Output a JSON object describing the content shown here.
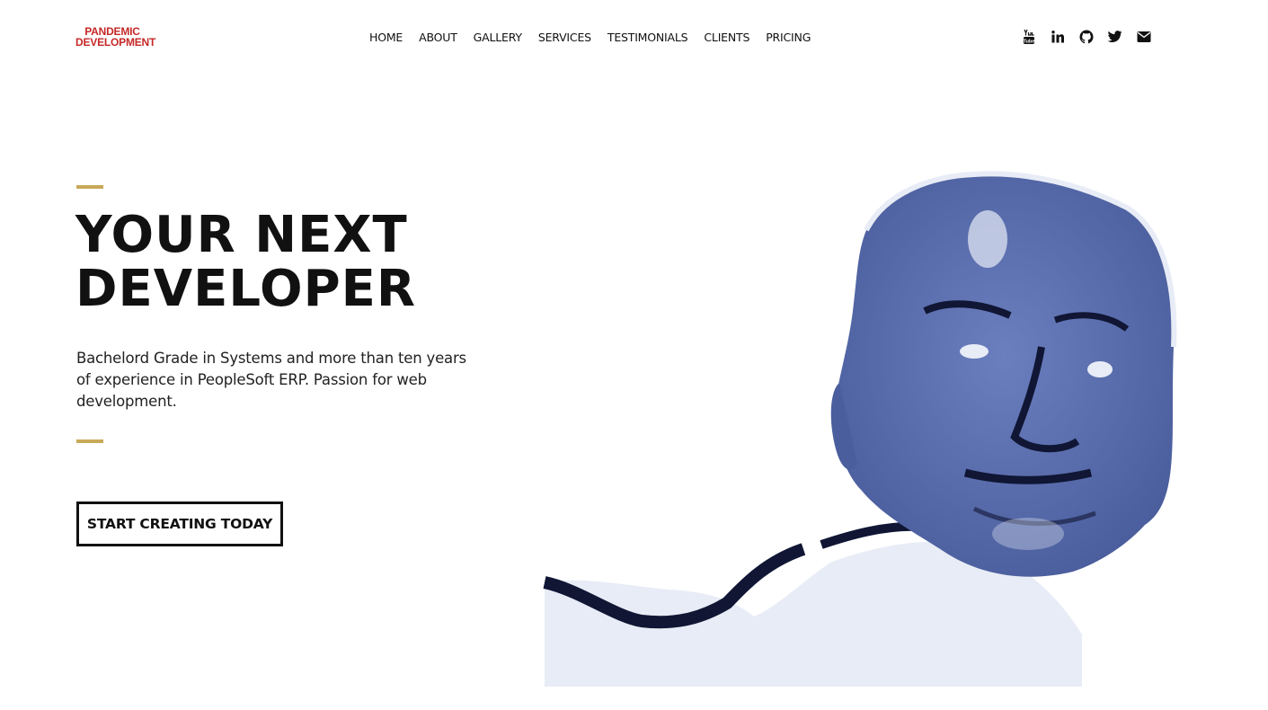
{
  "brand": {
    "line1": "PANDEMIC",
    "line2": "DEVELOPMENT",
    "color": "#c62828"
  },
  "nav": {
    "items": [
      {
        "label": "HOME"
      },
      {
        "label": "ABOUT"
      },
      {
        "label": "GALLERY"
      },
      {
        "label": "SERVICES"
      },
      {
        "label": "TESTIMONIALS"
      },
      {
        "label": "CLIENTS"
      },
      {
        "label": "PRICING"
      }
    ]
  },
  "social": {
    "icons": [
      "youtube-icon",
      "linkedin-icon",
      "github-icon",
      "twitter-icon",
      "envelope-icon"
    ],
    "youtube_text": "You Tube",
    "linkedin_text": "in"
  },
  "hero": {
    "title_line1": "YOUR NEXT",
    "title_line2": "DEVELOPER",
    "description": "Bachelord Grade in Systems and more than ten years of experience in PeopleSoft ERP. Passion for web development.",
    "cta_label": "START CREATING TODAY",
    "accent_color": "#c8a958"
  },
  "portrait": {
    "tint_color": "#4a5d9c",
    "highlight_color": "#e8ecf6",
    "shadow_color": "#101634"
  }
}
